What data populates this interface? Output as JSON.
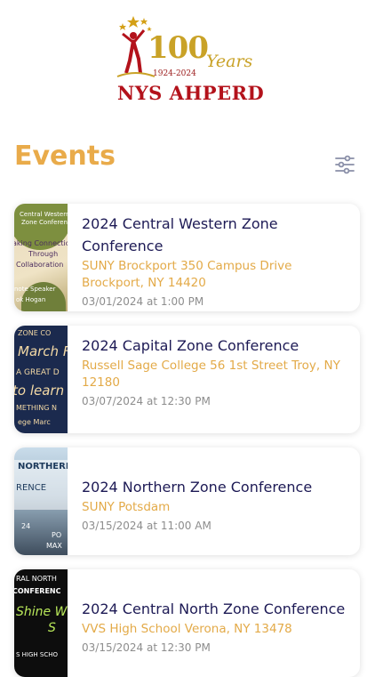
{
  "logo": {
    "number": "100",
    "word": "Years",
    "range": "1924-2024",
    "org": "NYS AHPERD"
  },
  "page": {
    "title": "Events"
  },
  "icons": {
    "filter": "sliders-icon"
  },
  "events": [
    {
      "title": "2024 Central Western Zone Conference",
      "location": "SUNY Brockport 350 Campus Drive Brockport, NY 14420",
      "datetime": "03/01/2024 at 1:00 PM",
      "thumb_lines": [
        "Central Western",
        "Zone Conference",
        "aking Connection",
        "Through",
        "Collaboration",
        "note Speaker",
        "ok Hogan"
      ]
    },
    {
      "title": "2024 Capital Zone Conference",
      "location": "Russell Sage College 56 1st Street Troy, NY 12180",
      "datetime": "03/07/2024 at 12:30 PM",
      "thumb_lines": [
        "ZONE CO",
        "March F",
        "A GREAT D",
        "to learn",
        "METHING N",
        "ege   Marc"
      ]
    },
    {
      "title": "2024 Northern Zone Conference",
      "location": "SUNY Potsdam",
      "datetime": "03/15/2024 at 11:00 AM",
      "thumb_lines": [
        "NORTHERN",
        "RENCE",
        "24",
        "PO",
        "MAX"
      ]
    },
    {
      "title": "2024 Central North Zone Conference",
      "location": "VVS High School Verona, NY 13478",
      "datetime": "03/15/2024 at 12:30 PM",
      "thumb_lines": [
        "RAL NORTH",
        "CONFERENC",
        "Shine W",
        "S",
        "S HIGH SCHO"
      ]
    }
  ],
  "colors": {
    "accent": "#e9ab4a",
    "title_text": "#1d1a55",
    "location_text": "#e3aa48",
    "date_text": "#8d8d8d",
    "brand_red": "#b3121b",
    "brand_gold": "#c9a227"
  }
}
